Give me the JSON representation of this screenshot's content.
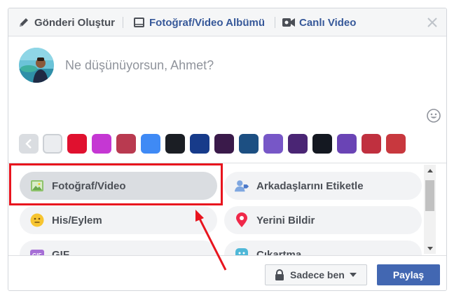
{
  "tabs": {
    "create_post": "Gönderi Oluştur",
    "photo_album": "Fotoğraf/Video Albümü",
    "live_video": "Canlı Video"
  },
  "composer": {
    "placeholder": "Ne düşünüyorsun, Ahmet?"
  },
  "background_swatches": [
    {
      "name": "white",
      "color": "#ebedf0"
    },
    {
      "name": "red",
      "color": "#e0112f"
    },
    {
      "name": "magenta",
      "color": "#c537d3"
    },
    {
      "name": "crimson",
      "color": "#b93a50"
    },
    {
      "name": "blue",
      "color": "#3f8af5"
    },
    {
      "name": "black",
      "color": "#1b1e24"
    },
    {
      "name": "navy",
      "color": "#173b8a"
    },
    {
      "name": "night-sky",
      "color": "#3a1a4a"
    },
    {
      "name": "ocean",
      "color": "#1c4f82"
    },
    {
      "name": "purple",
      "color": "#7757c7"
    },
    {
      "name": "galaxy",
      "color": "#4a2574"
    },
    {
      "name": "dark",
      "color": "#141821"
    },
    {
      "name": "violet",
      "color": "#6a44b5"
    },
    {
      "name": "rose",
      "color": "#c0303f"
    },
    {
      "name": "festive-red",
      "color": "#c8383e"
    }
  ],
  "options": {
    "photo_video": "Fotoğraf/Video",
    "tag_friends": "Arkadaşlarını Etiketle",
    "feeling": "His/Eylem",
    "check_in": "Yerini Bildir",
    "gif": "GIF",
    "sticker": "Çıkartma"
  },
  "footer": {
    "privacy": "Sadece ben",
    "share": "Paylaş"
  },
  "colors": {
    "brand_blue": "#4267b2",
    "annotation_red": "#e8141e"
  }
}
